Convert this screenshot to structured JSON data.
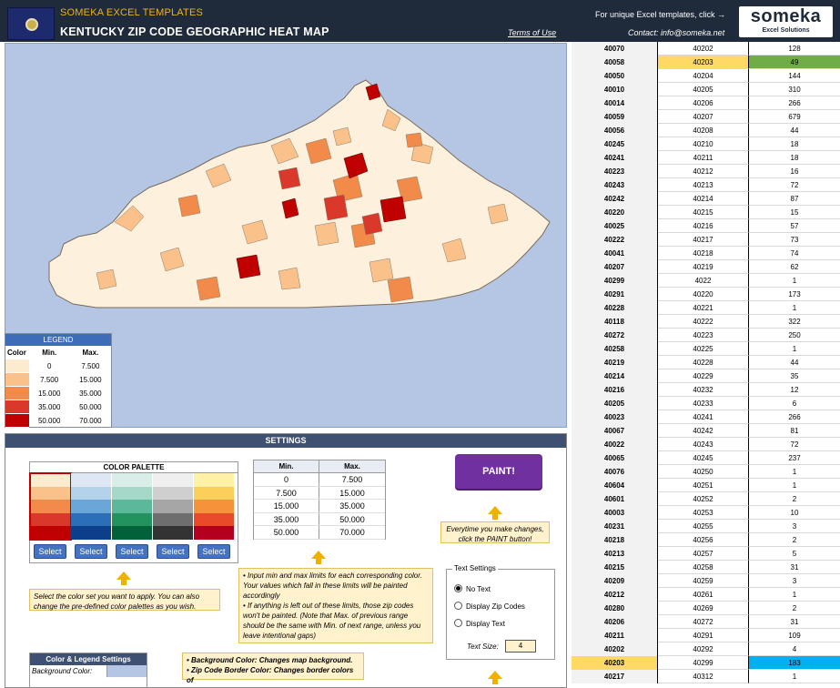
{
  "header": {
    "brand": "SOMEKA EXCEL TEMPLATES",
    "title": "KENTUCKY ZIP CODE GEOGRAPHIC HEAT MAP",
    "terms": "Terms of Use",
    "promo": "For unique Excel templates, click →",
    "contact": "Contact: info@someka.net",
    "logo_main": "someka",
    "logo_sub": "Excel Solutions"
  },
  "legend": {
    "title": "LEGEND",
    "col_color": "Color",
    "col_min": "Min.",
    "col_max": "Max.",
    "rows": [
      {
        "min": "0",
        "max": "7.500",
        "color": "#fdebd0"
      },
      {
        "min": "7.500",
        "max": "15.000",
        "color": "#fac28a"
      },
      {
        "min": "15.000",
        "max": "35.000",
        "color": "#f28b4a"
      },
      {
        "min": "35.000",
        "max": "50.000",
        "color": "#d9382a"
      },
      {
        "min": "50.000",
        "max": "70.000",
        "color": "#c00000"
      }
    ]
  },
  "settings": {
    "bar_title": "SETTINGS",
    "palette_title": "COLOR PALETTE",
    "select_label": "Select",
    "palettes": [
      [
        "#fdebd0",
        "#fac28a",
        "#f28b4a",
        "#d9382a",
        "#c00000"
      ],
      [
        "#dde8f4",
        "#b4d3ea",
        "#6aa6d8",
        "#2b6fb8",
        "#0b3f8c"
      ],
      [
        "#d9eee8",
        "#a5d8c9",
        "#5bb89a",
        "#22935e",
        "#00613a"
      ],
      [
        "#efefef",
        "#cfcfcf",
        "#a6a6a6",
        "#6e6e6e",
        "#333333"
      ],
      [
        "#fff2a8",
        "#fbd05a",
        "#f4933a",
        "#e94a2a",
        "#b4001e"
      ]
    ],
    "ranges_hdr_min": "Min.",
    "ranges_hdr_max": "Max.",
    "ranges": [
      {
        "min": "0",
        "max": "7.500"
      },
      {
        "min": "7.500",
        "max": "15.000"
      },
      {
        "min": "15.000",
        "max": "35.000"
      },
      {
        "min": "35.000",
        "max": "50.000"
      },
      {
        "min": "50.000",
        "max": "70.000"
      }
    ],
    "paint_label": "PAINT!",
    "paint_note": "Everytime you make changes, click the PAINT button!",
    "palette_note": "Select the color set you want to apply. You can also change the pre-defined color palettes as you wish.",
    "ranges_note_1": "• Input min and max limits for each corresponding color. Your values which fall in these limits will be painted accordingly",
    "ranges_note_2": "• If anything is left out of these limits, those zip codes won't be painted. (Note that Max. of previous range should be the same with Min. of next range, unless you leave intentional gaps)",
    "text_settings_title": "Text Settings",
    "text_options": [
      "No Text",
      "Display Zip Codes",
      "Display Text"
    ],
    "text_selected": "No Text",
    "text_size_label": "Text Size:",
    "text_size": "4",
    "cls_title": "Color & Legend Settings",
    "cls_bg_label": "Background Color:",
    "bg_note_1": "• Background Color: Changes map background.",
    "bg_note_2": "• Zip Code Border Color: Changes border colors of"
  },
  "table": {
    "rows": [
      [
        "40070",
        "40202",
        "128"
      ],
      [
        "40058",
        "40203",
        "49"
      ],
      [
        "40050",
        "40204",
        "144"
      ],
      [
        "40010",
        "40205",
        "310"
      ],
      [
        "40014",
        "40206",
        "266"
      ],
      [
        "40059",
        "40207",
        "679"
      ],
      [
        "40056",
        "40208",
        "44"
      ],
      [
        "40245",
        "40210",
        "18"
      ],
      [
        "40241",
        "40211",
        "18"
      ],
      [
        "40223",
        "40212",
        "16"
      ],
      [
        "40243",
        "40213",
        "72"
      ],
      [
        "40242",
        "40214",
        "87"
      ],
      [
        "40220",
        "40215",
        "15"
      ],
      [
        "40025",
        "40216",
        "57"
      ],
      [
        "40222",
        "40217",
        "73"
      ],
      [
        "40041",
        "40218",
        "74"
      ],
      [
        "40207",
        "40219",
        "62"
      ],
      [
        "40299",
        "4022",
        "1"
      ],
      [
        "40291",
        "40220",
        "173"
      ],
      [
        "40228",
        "40221",
        "1"
      ],
      [
        "40118",
        "40222",
        "322"
      ],
      [
        "40272",
        "40223",
        "250"
      ],
      [
        "40258",
        "40225",
        "1"
      ],
      [
        "40219",
        "40228",
        "44"
      ],
      [
        "40214",
        "40229",
        "35"
      ],
      [
        "40216",
        "40232",
        "12"
      ],
      [
        "40205",
        "40233",
        "6"
      ],
      [
        "40023",
        "40241",
        "266"
      ],
      [
        "40067",
        "40242",
        "81"
      ],
      [
        "40022",
        "40243",
        "72"
      ],
      [
        "40065",
        "40245",
        "237"
      ],
      [
        "40076",
        "40250",
        "1"
      ],
      [
        "40604",
        "40251",
        "1"
      ],
      [
        "40601",
        "40252",
        "2"
      ],
      [
        "40003",
        "40253",
        "10"
      ],
      [
        "40231",
        "40255",
        "3"
      ],
      [
        "40218",
        "40256",
        "2"
      ],
      [
        "40213",
        "40257",
        "5"
      ],
      [
        "40215",
        "40258",
        "31"
      ],
      [
        "40209",
        "40259",
        "3"
      ],
      [
        "40212",
        "40261",
        "1"
      ],
      [
        "40280",
        "40269",
        "2"
      ],
      [
        "40206",
        "40272",
        "31"
      ],
      [
        "40211",
        "40291",
        "109"
      ],
      [
        "40202",
        "40292",
        "4"
      ],
      [
        "40203",
        "40299",
        "183"
      ],
      [
        "40217",
        "40312",
        "1"
      ]
    ]
  }
}
